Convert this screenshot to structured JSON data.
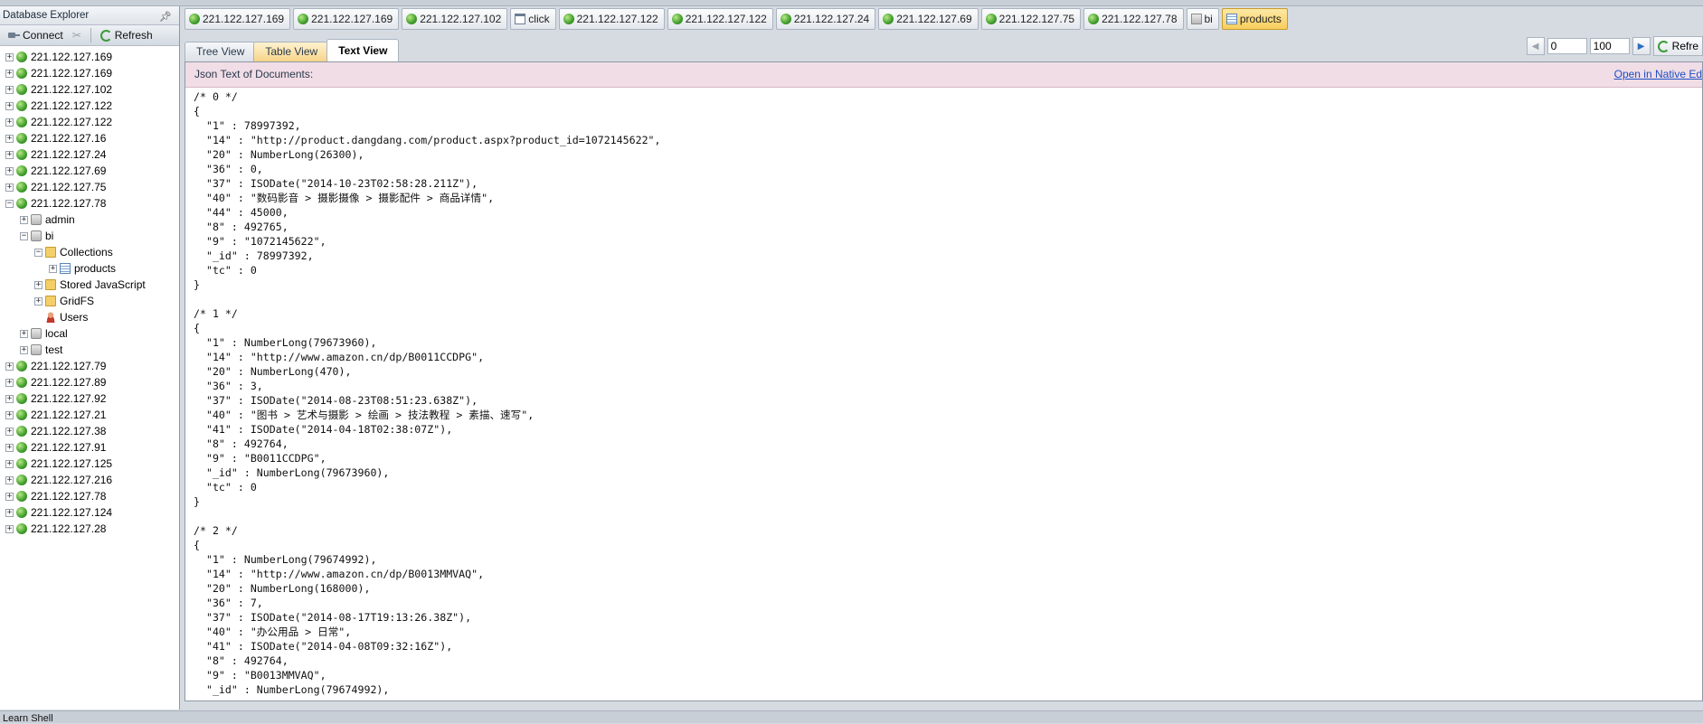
{
  "left_panel": {
    "title": "Database Explorer",
    "connect_label": "Connect",
    "refresh_label": "Refresh",
    "tree": [
      {
        "label": "221.122.127.169",
        "type": "server",
        "level": 0,
        "exp": "+"
      },
      {
        "label": "221.122.127.169",
        "type": "server",
        "level": 0,
        "exp": "+"
      },
      {
        "label": "221.122.127.102",
        "type": "server",
        "level": 0,
        "exp": "+"
      },
      {
        "label": "221.122.127.122",
        "type": "server",
        "level": 0,
        "exp": "+"
      },
      {
        "label": "221.122.127.122",
        "type": "server",
        "level": 0,
        "exp": "+"
      },
      {
        "label": "221.122.127.16",
        "type": "server",
        "level": 0,
        "exp": "+"
      },
      {
        "label": "221.122.127.24",
        "type": "server",
        "level": 0,
        "exp": "+"
      },
      {
        "label": "221.122.127.69",
        "type": "server",
        "level": 0,
        "exp": "+"
      },
      {
        "label": "221.122.127.75",
        "type": "server",
        "level": 0,
        "exp": "+"
      },
      {
        "label": "221.122.127.78",
        "type": "server",
        "level": 0,
        "exp": "-"
      },
      {
        "label": "admin",
        "type": "db",
        "level": 1,
        "exp": "+"
      },
      {
        "label": "bi",
        "type": "db",
        "level": 1,
        "exp": "-"
      },
      {
        "label": "Collections",
        "type": "folder",
        "level": 2,
        "exp": "-"
      },
      {
        "label": "products",
        "type": "table",
        "level": 3,
        "exp": "+"
      },
      {
        "label": "Stored JavaScript",
        "type": "folder",
        "level": 2,
        "exp": "+"
      },
      {
        "label": "GridFS",
        "type": "folder",
        "level": 2,
        "exp": "+"
      },
      {
        "label": "Users",
        "type": "users",
        "level": 2,
        "exp": ""
      },
      {
        "label": "local",
        "type": "db",
        "level": 1,
        "exp": "+"
      },
      {
        "label": "test",
        "type": "db",
        "level": 1,
        "exp": "+"
      },
      {
        "label": "221.122.127.79",
        "type": "server",
        "level": 0,
        "exp": "+"
      },
      {
        "label": "221.122.127.89",
        "type": "server",
        "level": 0,
        "exp": "+"
      },
      {
        "label": "221.122.127.92",
        "type": "server",
        "level": 0,
        "exp": "+"
      },
      {
        "label": "221.122.127.21",
        "type": "server",
        "level": 0,
        "exp": "+"
      },
      {
        "label": "221.122.127.38",
        "type": "server",
        "level": 0,
        "exp": "+"
      },
      {
        "label": "221.122.127.91",
        "type": "server",
        "level": 0,
        "exp": "+"
      },
      {
        "label": "221.122.127.125",
        "type": "server",
        "level": 0,
        "exp": "+"
      },
      {
        "label": "221.122.127.216",
        "type": "server",
        "level": 0,
        "exp": "+"
      },
      {
        "label": "221.122.127.78",
        "type": "server",
        "level": 0,
        "exp": "+"
      },
      {
        "label": "221.122.127.124",
        "type": "server",
        "level": 0,
        "exp": "+"
      },
      {
        "label": "221.122.127.28",
        "type": "server",
        "level": 0,
        "exp": "+"
      }
    ]
  },
  "document_tabs": [
    {
      "label": "221.122.127.169",
      "icon": "server"
    },
    {
      "label": "221.122.127.169",
      "icon": "server"
    },
    {
      "label": "221.122.127.102",
      "icon": "server"
    },
    {
      "label": "click",
      "icon": "shell"
    },
    {
      "label": "221.122.127.122",
      "icon": "server"
    },
    {
      "label": "221.122.127.122",
      "icon": "server"
    },
    {
      "label": "221.122.127.24",
      "icon": "server"
    },
    {
      "label": "221.122.127.69",
      "icon": "server"
    },
    {
      "label": "221.122.127.75",
      "icon": "server"
    },
    {
      "label": "221.122.127.78",
      "icon": "server"
    },
    {
      "label": "bi",
      "icon": "db"
    },
    {
      "label": "products",
      "icon": "table",
      "active": true
    }
  ],
  "view_tabs": {
    "tree": "Tree View",
    "table": "Table View",
    "text": "Text View"
  },
  "pager": {
    "skip": "0",
    "limit": "100",
    "refresh_label": "Refre"
  },
  "doc_panel": {
    "header": "Json Text of Documents:",
    "open_native_label": "Open in Native Ed",
    "json_text": "/* 0 */\n{\n  \"1\" : 78997392,\n  \"14\" : \"http://product.dangdang.com/product.aspx?product_id=1072145622\",\n  \"20\" : NumberLong(26300),\n  \"36\" : 0,\n  \"37\" : ISODate(\"2014-10-23T02:58:28.211Z\"),\n  \"40\" : \"数码影音 > 摄影摄像 > 摄影配件 > 商品详情\",\n  \"44\" : 45000,\n  \"8\" : 492765,\n  \"9\" : \"1072145622\",\n  \"_id\" : 78997392,\n  \"tc\" : 0\n}\n\n/* 1 */\n{\n  \"1\" : NumberLong(79673960),\n  \"14\" : \"http://www.amazon.cn/dp/B0011CCDPG\",\n  \"20\" : NumberLong(470),\n  \"36\" : 3,\n  \"37\" : ISODate(\"2014-08-23T08:51:23.638Z\"),\n  \"40\" : \"图书 > 艺术与摄影 > 绘画 > 技法教程 > 素描、速写\",\n  \"41\" : ISODate(\"2014-04-18T02:38:07Z\"),\n  \"8\" : 492764,\n  \"9\" : \"B0011CCDPG\",\n  \"_id\" : NumberLong(79673960),\n  \"tc\" : 0\n}\n\n/* 2 */\n{\n  \"1\" : NumberLong(79674992),\n  \"14\" : \"http://www.amazon.cn/dp/B0013MMVAQ\",\n  \"20\" : NumberLong(168000),\n  \"36\" : 7,\n  \"37\" : ISODate(\"2014-08-17T19:13:26.38Z\"),\n  \"40\" : \"办公用品 > 日常\",\n  \"41\" : ISODate(\"2014-04-08T09:32:16Z\"),\n  \"8\" : 492764,\n  \"9\" : \"B0013MMVAQ\",\n  \"_id\" : NumberLong(79674992),"
  },
  "status_bar": {
    "label": "Learn Shell"
  }
}
